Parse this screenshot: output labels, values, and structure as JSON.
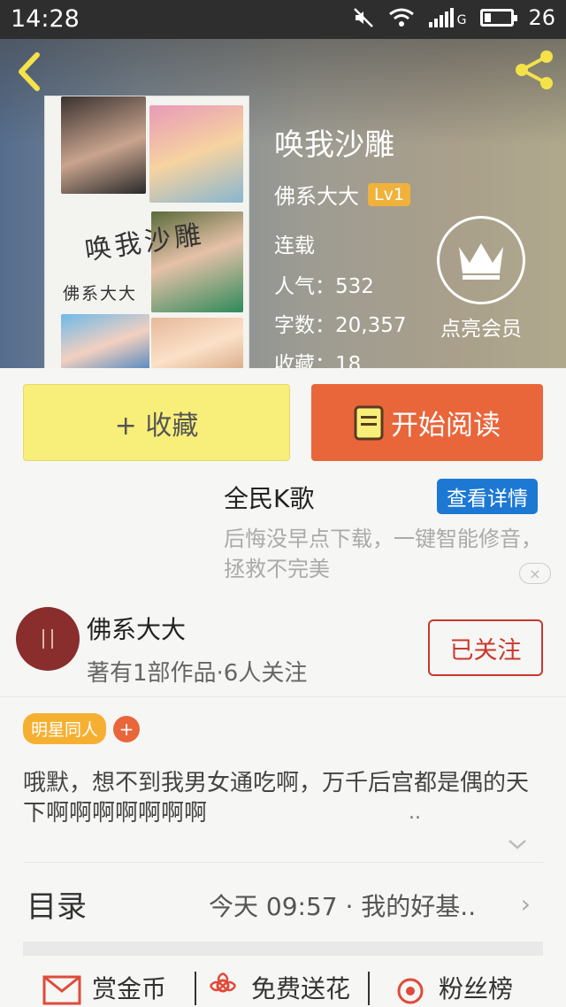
{
  "status_bar": {
    "time": "14:28",
    "network": "G",
    "battery": "26",
    "battery_level": 0.26
  },
  "book": {
    "title": "唤我沙雕",
    "author": "佛系大大",
    "level_badge": "Lv1",
    "status": "连载",
    "popularity": "人气：532",
    "word_count": "字数：20,357",
    "favorites": "收藏：18",
    "cover_title": "唤我沙雕",
    "cover_author": "佛系大大"
  },
  "vip": {
    "label": "点亮会员",
    "icon": "crown-icon"
  },
  "actions": {
    "collect_label": "+ 收藏",
    "read_label": "开始阅读"
  },
  "ad": {
    "title": "全民K歌",
    "button": "查看详情",
    "description": "后悔没早点下载，一键智能修音，拯救不完美",
    "close": "×"
  },
  "author_card": {
    "name": "佛系大大",
    "info": "著有1部作品·6人关注",
    "follow_label": "已关注"
  },
  "tags": [
    {
      "label": "明星同人"
    }
  ],
  "tag_add": "+",
  "intro": {
    "text": "哦默，想不到我男女通吃啊，万千后宫都是偶的天下啊啊啊啊啊啊啊",
    "ellipsis": ".."
  },
  "toc": {
    "label": "目录",
    "latest": "今天 09:57 · 我的好基..",
    "arrow": "›"
  },
  "bottom_bar": {
    "reward": "赏金币",
    "flower": "免费送花",
    "fans": "粉丝榜"
  },
  "colors": {
    "accent_orange": "#e9663b",
    "collect_yellow": "#f8ef7a",
    "follow_red": "#c9382c",
    "tag_orange": "#f6b031",
    "ad_blue": "#1c78d3"
  }
}
